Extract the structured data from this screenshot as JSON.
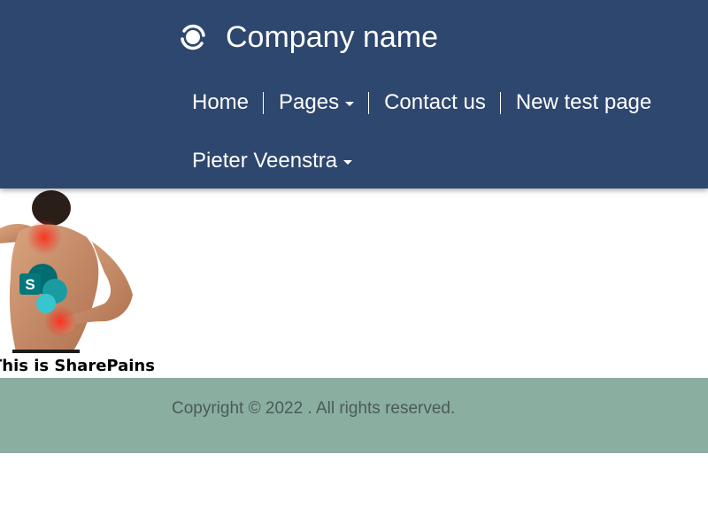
{
  "header": {
    "brand_name": "Company name",
    "brand_icon": "company-logo-icon",
    "nav": [
      {
        "label": "Home",
        "has_dropdown": false
      },
      {
        "label": "Pages",
        "has_dropdown": true
      },
      {
        "label": "Contact us",
        "has_dropdown": false
      },
      {
        "label": "New test page",
        "has_dropdown": false
      }
    ],
    "user": {
      "label": "Pieter Veenstra",
      "has_dropdown": true
    }
  },
  "main": {
    "hero_caption": "This is SharePains",
    "hero_image": "sharepoint-back-pain-image"
  },
  "footer": {
    "copyright": "Copyright © 2022 . All rights reserved."
  },
  "colors": {
    "header_bg": "#2e476e",
    "footer_bg": "#8aaea0",
    "footer_text": "#4c5a58",
    "sharepoint_teal": "#038387"
  }
}
